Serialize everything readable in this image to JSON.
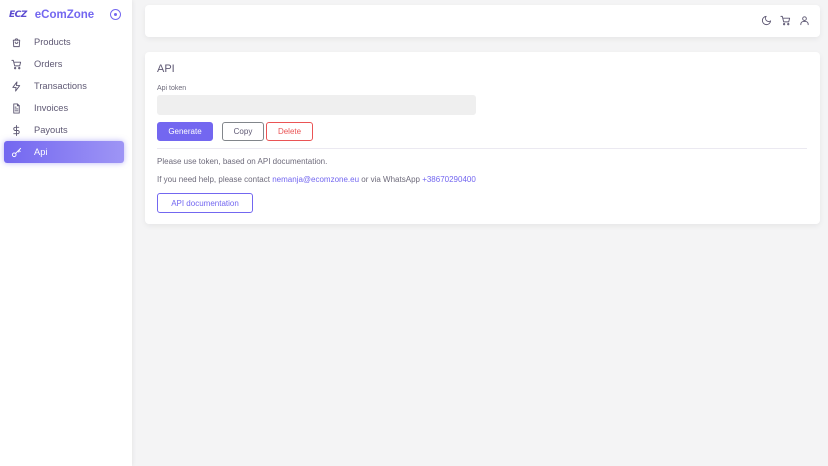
{
  "brand": {
    "logo": "ECZ",
    "name": "eComZone",
    "collapse_icon": "circle-dot-icon"
  },
  "sidebar": {
    "items": [
      {
        "label": "Products",
        "icon": "shopping-bag-icon",
        "active": false
      },
      {
        "label": "Orders",
        "icon": "cart-icon",
        "active": false
      },
      {
        "label": "Transactions",
        "icon": "lightning-icon",
        "active": false
      },
      {
        "label": "Invoices",
        "icon": "file-text-icon",
        "active": false
      },
      {
        "label": "Payouts",
        "icon": "dollar-icon",
        "active": false
      },
      {
        "label": "Api",
        "icon": "key-icon",
        "active": true
      }
    ]
  },
  "header": {
    "icons": [
      "moon-icon",
      "cart-icon",
      "user-icon"
    ]
  },
  "api_card": {
    "title": "API",
    "token_label": "Api token",
    "token_value": "",
    "generate_label": "Generate",
    "copy_label": "Copy",
    "delete_label": "Delete",
    "info_text": "Please use token, based on API documentation.",
    "help_prefix": "If you need help, please contact ",
    "help_email": "nemanja@ecomzone.eu",
    "help_middle": " or via WhatsApp ",
    "help_phone": "+38670290400",
    "docs_label": "API documentation"
  },
  "colors": {
    "accent": "#7367f0",
    "danger": "#ea5455",
    "background": "#f4f4f5"
  }
}
